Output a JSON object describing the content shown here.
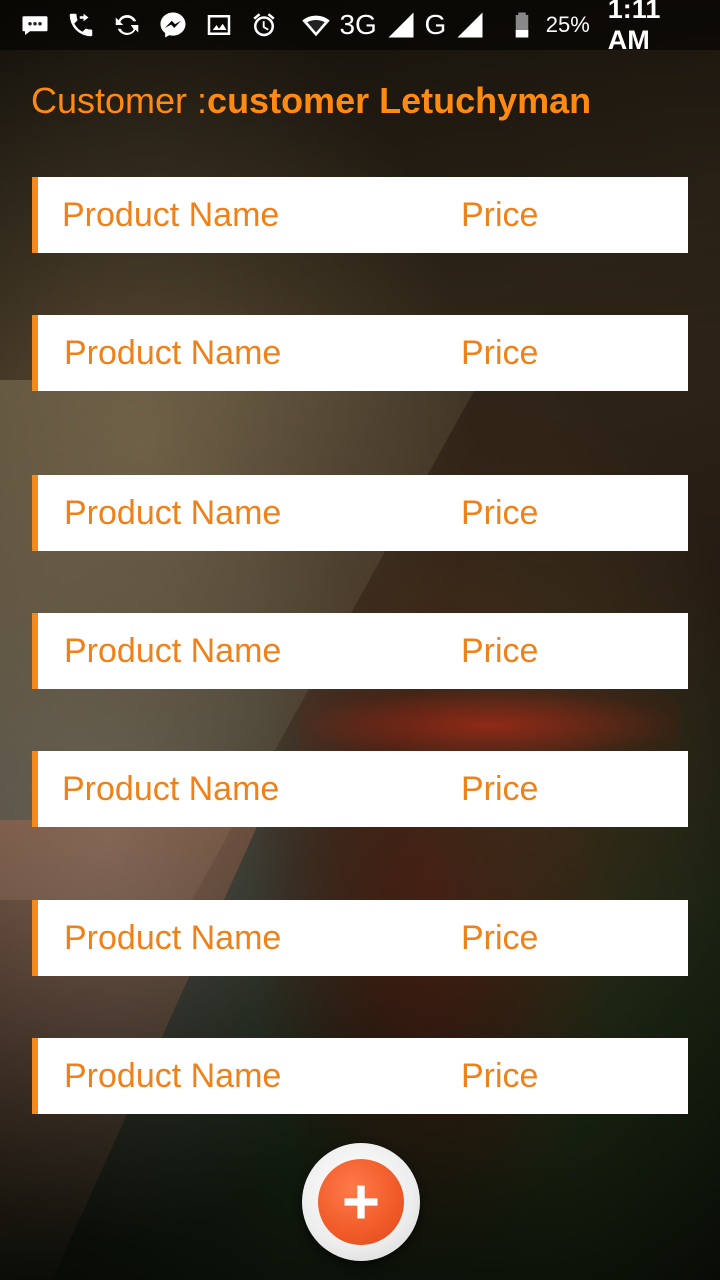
{
  "status_bar": {
    "left_icons": [
      "chat-bubble-icon",
      "call-forward-icon",
      "sync-icon",
      "messenger-icon",
      "image-icon"
    ],
    "network_3g": "3G",
    "network_g": "G",
    "battery_percent": "25%",
    "time": "1:11 AM"
  },
  "header": {
    "label": "Customer :",
    "customer_name": "customer Letuchyman"
  },
  "products": [
    {
      "name": "Product Name",
      "price": "Price"
    },
    {
      "name": "Product Name",
      "price": "Price"
    },
    {
      "name": "Product Name",
      "price": "Price"
    },
    {
      "name": "Product Name",
      "price": "Price"
    },
    {
      "name": "Product Name",
      "price": "Price"
    },
    {
      "name": "Product Name",
      "price": "Price"
    },
    {
      "name": "Product Name",
      "price": "Price"
    }
  ],
  "fab": {
    "icon": "plus-icon"
  },
  "colors": {
    "accent_orange": "#ff8a0f",
    "row_text": "#f08119",
    "fab": "#f05a28"
  }
}
